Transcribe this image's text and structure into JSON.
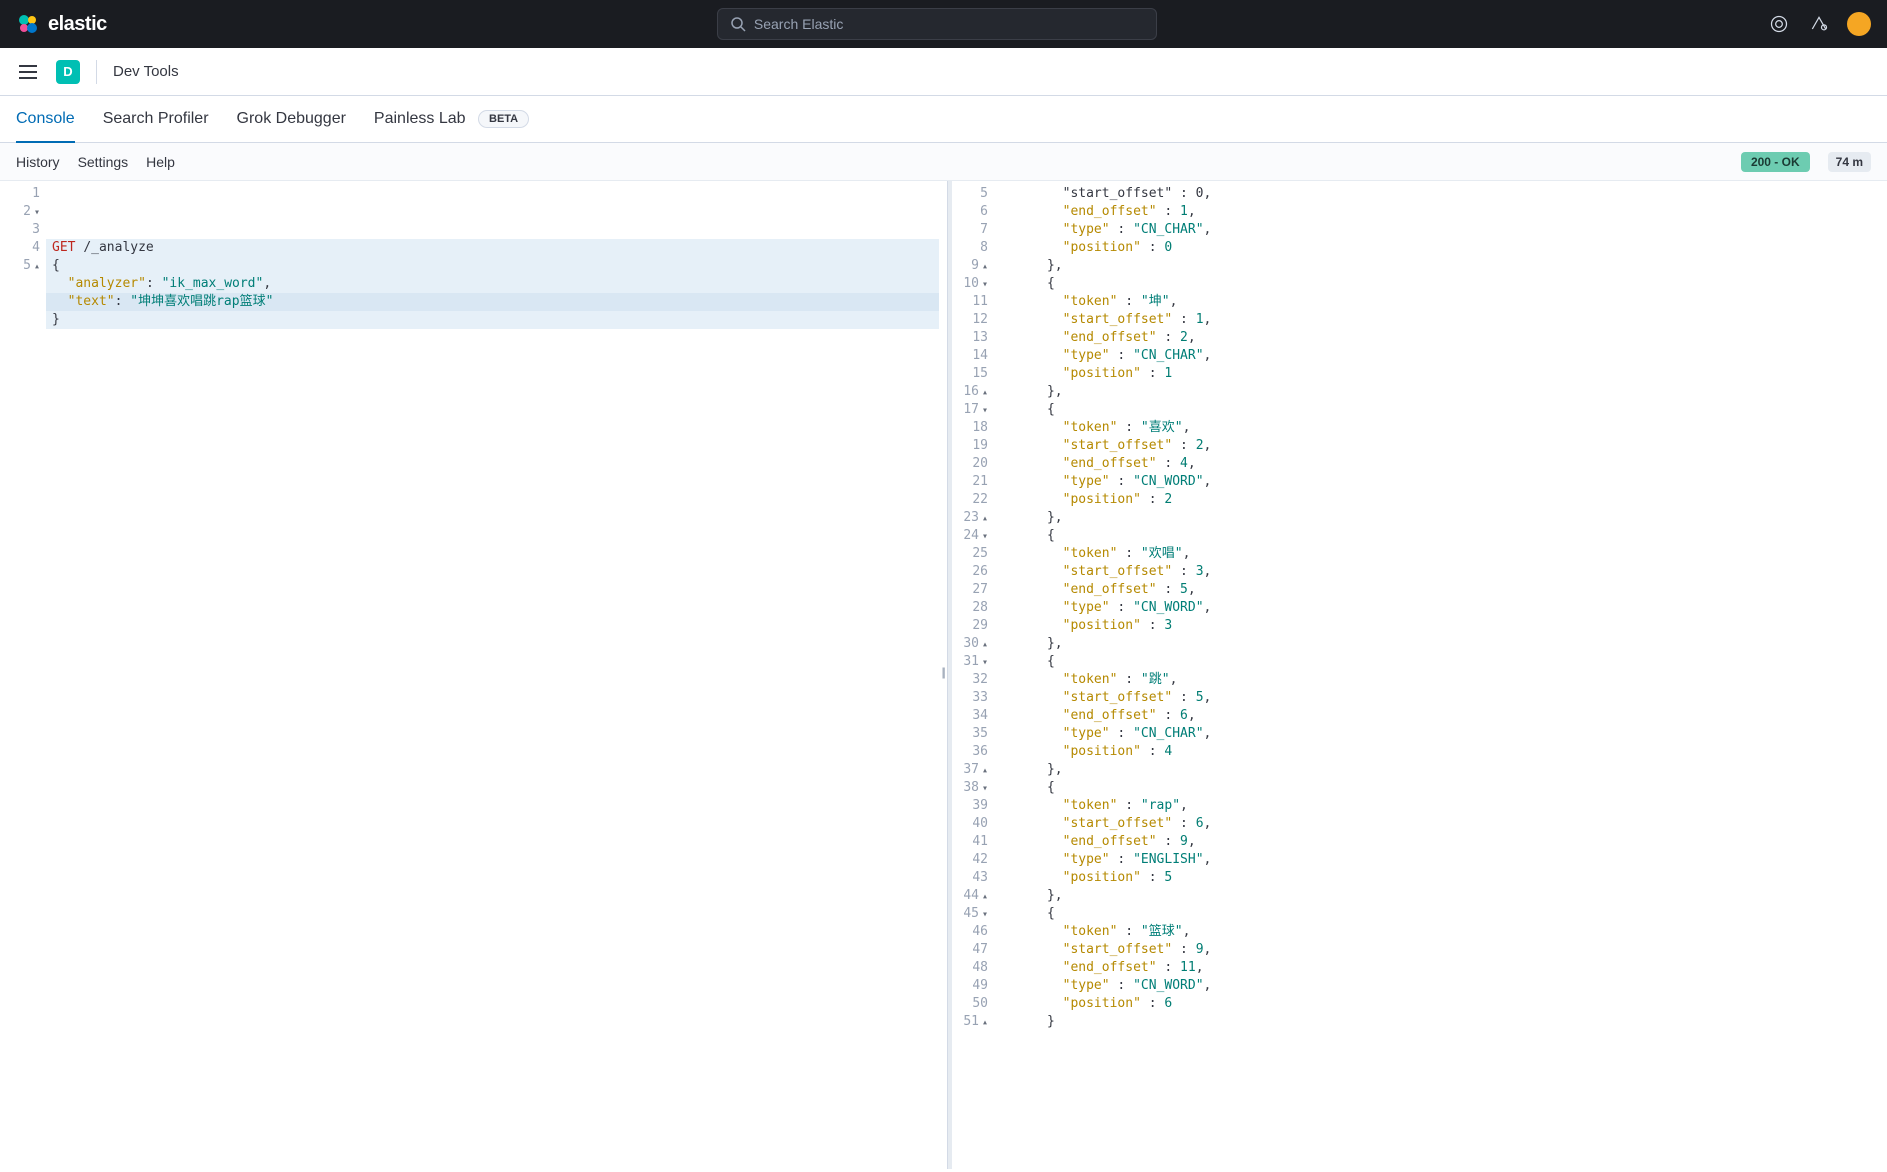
{
  "header": {
    "brand": "elastic",
    "search_placeholder": "Search Elastic"
  },
  "nav": {
    "space_letter": "D",
    "breadcrumb": "Dev Tools"
  },
  "tabs": [
    {
      "label": "Console",
      "active": true
    },
    {
      "label": "Search Profiler",
      "active": false
    },
    {
      "label": "Grok Debugger",
      "active": false
    },
    {
      "label": "Painless Lab",
      "active": false,
      "beta": true
    }
  ],
  "beta_label": "BETA",
  "subtoolbar": {
    "history": "History",
    "settings": "Settings",
    "help": "Help",
    "status": "200 - OK",
    "timing": "74 m"
  },
  "request": {
    "lines": [
      {
        "n": "1",
        "fold": "",
        "parts": [
          {
            "cls": "method",
            "t": "GET"
          },
          {
            "cls": "punct",
            "t": " "
          },
          {
            "cls": "endpoint",
            "t": "/_analyze"
          }
        ]
      },
      {
        "n": "2",
        "fold": "▾",
        "parts": [
          {
            "cls": "punct",
            "t": "{"
          }
        ]
      },
      {
        "n": "3",
        "fold": "",
        "parts": [
          {
            "cls": "punct",
            "t": "  "
          },
          {
            "cls": "key",
            "t": "\"analyzer\""
          },
          {
            "cls": "punct",
            "t": ": "
          },
          {
            "cls": "str",
            "t": "\"ik_max_word\""
          },
          {
            "cls": "punct",
            "t": ","
          }
        ]
      },
      {
        "n": "4",
        "fold": "",
        "active": true,
        "parts": [
          {
            "cls": "punct",
            "t": "  "
          },
          {
            "cls": "key",
            "t": "\"text\""
          },
          {
            "cls": "punct",
            "t": ": "
          },
          {
            "cls": "str",
            "t": "\"坤坤喜欢唱跳rap篮球\""
          }
        ]
      },
      {
        "n": "5",
        "fold": "▴",
        "parts": [
          {
            "cls": "punct",
            "t": "}"
          }
        ]
      }
    ]
  },
  "response": {
    "lines": [
      {
        "n": "5",
        "fold": "",
        "parts": [
          {
            "cls": "punct",
            "t": "        \"start_offset\" : 0,"
          }
        ]
      },
      {
        "n": "6",
        "fold": "",
        "parts": [
          {
            "cls": "punct",
            "t": "        "
          },
          {
            "cls": "key",
            "t": "\"end_offset\""
          },
          {
            "cls": "punct",
            "t": " : "
          },
          {
            "cls": "num",
            "t": "1"
          },
          {
            "cls": "punct",
            "t": ","
          }
        ]
      },
      {
        "n": "7",
        "fold": "",
        "parts": [
          {
            "cls": "punct",
            "t": "        "
          },
          {
            "cls": "key",
            "t": "\"type\""
          },
          {
            "cls": "punct",
            "t": " : "
          },
          {
            "cls": "str",
            "t": "\"CN_CHAR\""
          },
          {
            "cls": "punct",
            "t": ","
          }
        ]
      },
      {
        "n": "8",
        "fold": "",
        "parts": [
          {
            "cls": "punct",
            "t": "        "
          },
          {
            "cls": "key",
            "t": "\"position\""
          },
          {
            "cls": "punct",
            "t": " : "
          },
          {
            "cls": "num",
            "t": "0"
          }
        ]
      },
      {
        "n": "9",
        "fold": "▴",
        "parts": [
          {
            "cls": "punct",
            "t": "      },"
          }
        ]
      },
      {
        "n": "10",
        "fold": "▾",
        "parts": [
          {
            "cls": "punct",
            "t": "      {"
          }
        ]
      },
      {
        "n": "11",
        "fold": "",
        "parts": [
          {
            "cls": "punct",
            "t": "        "
          },
          {
            "cls": "key",
            "t": "\"token\""
          },
          {
            "cls": "punct",
            "t": " : "
          },
          {
            "cls": "str",
            "t": "\"坤\""
          },
          {
            "cls": "punct",
            "t": ","
          }
        ]
      },
      {
        "n": "12",
        "fold": "",
        "parts": [
          {
            "cls": "punct",
            "t": "        "
          },
          {
            "cls": "key",
            "t": "\"start_offset\""
          },
          {
            "cls": "punct",
            "t": " : "
          },
          {
            "cls": "num",
            "t": "1"
          },
          {
            "cls": "punct",
            "t": ","
          }
        ]
      },
      {
        "n": "13",
        "fold": "",
        "parts": [
          {
            "cls": "punct",
            "t": "        "
          },
          {
            "cls": "key",
            "t": "\"end_offset\""
          },
          {
            "cls": "punct",
            "t": " : "
          },
          {
            "cls": "num",
            "t": "2"
          },
          {
            "cls": "punct",
            "t": ","
          }
        ]
      },
      {
        "n": "14",
        "fold": "",
        "parts": [
          {
            "cls": "punct",
            "t": "        "
          },
          {
            "cls": "key",
            "t": "\"type\""
          },
          {
            "cls": "punct",
            "t": " : "
          },
          {
            "cls": "str",
            "t": "\"CN_CHAR\""
          },
          {
            "cls": "punct",
            "t": ","
          }
        ]
      },
      {
        "n": "15",
        "fold": "",
        "parts": [
          {
            "cls": "punct",
            "t": "        "
          },
          {
            "cls": "key",
            "t": "\"position\""
          },
          {
            "cls": "punct",
            "t": " : "
          },
          {
            "cls": "num",
            "t": "1"
          }
        ]
      },
      {
        "n": "16",
        "fold": "▴",
        "parts": [
          {
            "cls": "punct",
            "t": "      },"
          }
        ]
      },
      {
        "n": "17",
        "fold": "▾",
        "parts": [
          {
            "cls": "punct",
            "t": "      {"
          }
        ]
      },
      {
        "n": "18",
        "fold": "",
        "parts": [
          {
            "cls": "punct",
            "t": "        "
          },
          {
            "cls": "key",
            "t": "\"token\""
          },
          {
            "cls": "punct",
            "t": " : "
          },
          {
            "cls": "str",
            "t": "\"喜欢\""
          },
          {
            "cls": "punct",
            "t": ","
          }
        ]
      },
      {
        "n": "19",
        "fold": "",
        "parts": [
          {
            "cls": "punct",
            "t": "        "
          },
          {
            "cls": "key",
            "t": "\"start_offset\""
          },
          {
            "cls": "punct",
            "t": " : "
          },
          {
            "cls": "num",
            "t": "2"
          },
          {
            "cls": "punct",
            "t": ","
          }
        ]
      },
      {
        "n": "20",
        "fold": "",
        "parts": [
          {
            "cls": "punct",
            "t": "        "
          },
          {
            "cls": "key",
            "t": "\"end_offset\""
          },
          {
            "cls": "punct",
            "t": " : "
          },
          {
            "cls": "num",
            "t": "4"
          },
          {
            "cls": "punct",
            "t": ","
          }
        ]
      },
      {
        "n": "21",
        "fold": "",
        "parts": [
          {
            "cls": "punct",
            "t": "        "
          },
          {
            "cls": "key",
            "t": "\"type\""
          },
          {
            "cls": "punct",
            "t": " : "
          },
          {
            "cls": "str",
            "t": "\"CN_WORD\""
          },
          {
            "cls": "punct",
            "t": ","
          }
        ]
      },
      {
        "n": "22",
        "fold": "",
        "parts": [
          {
            "cls": "punct",
            "t": "        "
          },
          {
            "cls": "key",
            "t": "\"position\""
          },
          {
            "cls": "punct",
            "t": " : "
          },
          {
            "cls": "num",
            "t": "2"
          }
        ]
      },
      {
        "n": "23",
        "fold": "▴",
        "parts": [
          {
            "cls": "punct",
            "t": "      },"
          }
        ]
      },
      {
        "n": "24",
        "fold": "▾",
        "parts": [
          {
            "cls": "punct",
            "t": "      {"
          }
        ]
      },
      {
        "n": "25",
        "fold": "",
        "parts": [
          {
            "cls": "punct",
            "t": "        "
          },
          {
            "cls": "key",
            "t": "\"token\""
          },
          {
            "cls": "punct",
            "t": " : "
          },
          {
            "cls": "str",
            "t": "\"欢唱\""
          },
          {
            "cls": "punct",
            "t": ","
          }
        ]
      },
      {
        "n": "26",
        "fold": "",
        "parts": [
          {
            "cls": "punct",
            "t": "        "
          },
          {
            "cls": "key",
            "t": "\"start_offset\""
          },
          {
            "cls": "punct",
            "t": " : "
          },
          {
            "cls": "num",
            "t": "3"
          },
          {
            "cls": "punct",
            "t": ","
          }
        ]
      },
      {
        "n": "27",
        "fold": "",
        "parts": [
          {
            "cls": "punct",
            "t": "        "
          },
          {
            "cls": "key",
            "t": "\"end_offset\""
          },
          {
            "cls": "punct",
            "t": " : "
          },
          {
            "cls": "num",
            "t": "5"
          },
          {
            "cls": "punct",
            "t": ","
          }
        ]
      },
      {
        "n": "28",
        "fold": "",
        "parts": [
          {
            "cls": "punct",
            "t": "        "
          },
          {
            "cls": "key",
            "t": "\"type\""
          },
          {
            "cls": "punct",
            "t": " : "
          },
          {
            "cls": "str",
            "t": "\"CN_WORD\""
          },
          {
            "cls": "punct",
            "t": ","
          }
        ]
      },
      {
        "n": "29",
        "fold": "",
        "parts": [
          {
            "cls": "punct",
            "t": "        "
          },
          {
            "cls": "key",
            "t": "\"position\""
          },
          {
            "cls": "punct",
            "t": " : "
          },
          {
            "cls": "num",
            "t": "3"
          }
        ]
      },
      {
        "n": "30",
        "fold": "▴",
        "parts": [
          {
            "cls": "punct",
            "t": "      },"
          }
        ]
      },
      {
        "n": "31",
        "fold": "▾",
        "parts": [
          {
            "cls": "punct",
            "t": "      {"
          }
        ]
      },
      {
        "n": "32",
        "fold": "",
        "parts": [
          {
            "cls": "punct",
            "t": "        "
          },
          {
            "cls": "key",
            "t": "\"token\""
          },
          {
            "cls": "punct",
            "t": " : "
          },
          {
            "cls": "str",
            "t": "\"跳\""
          },
          {
            "cls": "punct",
            "t": ","
          }
        ]
      },
      {
        "n": "33",
        "fold": "",
        "parts": [
          {
            "cls": "punct",
            "t": "        "
          },
          {
            "cls": "key",
            "t": "\"start_offset\""
          },
          {
            "cls": "punct",
            "t": " : "
          },
          {
            "cls": "num",
            "t": "5"
          },
          {
            "cls": "punct",
            "t": ","
          }
        ]
      },
      {
        "n": "34",
        "fold": "",
        "parts": [
          {
            "cls": "punct",
            "t": "        "
          },
          {
            "cls": "key",
            "t": "\"end_offset\""
          },
          {
            "cls": "punct",
            "t": " : "
          },
          {
            "cls": "num",
            "t": "6"
          },
          {
            "cls": "punct",
            "t": ","
          }
        ]
      },
      {
        "n": "35",
        "fold": "",
        "parts": [
          {
            "cls": "punct",
            "t": "        "
          },
          {
            "cls": "key",
            "t": "\"type\""
          },
          {
            "cls": "punct",
            "t": " : "
          },
          {
            "cls": "str",
            "t": "\"CN_CHAR\""
          },
          {
            "cls": "punct",
            "t": ","
          }
        ]
      },
      {
        "n": "36",
        "fold": "",
        "parts": [
          {
            "cls": "punct",
            "t": "        "
          },
          {
            "cls": "key",
            "t": "\"position\""
          },
          {
            "cls": "punct",
            "t": " : "
          },
          {
            "cls": "num",
            "t": "4"
          }
        ]
      },
      {
        "n": "37",
        "fold": "▴",
        "parts": [
          {
            "cls": "punct",
            "t": "      },"
          }
        ]
      },
      {
        "n": "38",
        "fold": "▾",
        "parts": [
          {
            "cls": "punct",
            "t": "      {"
          }
        ]
      },
      {
        "n": "39",
        "fold": "",
        "parts": [
          {
            "cls": "punct",
            "t": "        "
          },
          {
            "cls": "key",
            "t": "\"token\""
          },
          {
            "cls": "punct",
            "t": " : "
          },
          {
            "cls": "str",
            "t": "\"rap\""
          },
          {
            "cls": "punct",
            "t": ","
          }
        ]
      },
      {
        "n": "40",
        "fold": "",
        "parts": [
          {
            "cls": "punct",
            "t": "        "
          },
          {
            "cls": "key",
            "t": "\"start_offset\""
          },
          {
            "cls": "punct",
            "t": " : "
          },
          {
            "cls": "num",
            "t": "6"
          },
          {
            "cls": "punct",
            "t": ","
          }
        ]
      },
      {
        "n": "41",
        "fold": "",
        "parts": [
          {
            "cls": "punct",
            "t": "        "
          },
          {
            "cls": "key",
            "t": "\"end_offset\""
          },
          {
            "cls": "punct",
            "t": " : "
          },
          {
            "cls": "num",
            "t": "9"
          },
          {
            "cls": "punct",
            "t": ","
          }
        ]
      },
      {
        "n": "42",
        "fold": "",
        "parts": [
          {
            "cls": "punct",
            "t": "        "
          },
          {
            "cls": "key",
            "t": "\"type\""
          },
          {
            "cls": "punct",
            "t": " : "
          },
          {
            "cls": "str",
            "t": "\"ENGLISH\""
          },
          {
            "cls": "punct",
            "t": ","
          }
        ]
      },
      {
        "n": "43",
        "fold": "",
        "parts": [
          {
            "cls": "punct",
            "t": "        "
          },
          {
            "cls": "key",
            "t": "\"position\""
          },
          {
            "cls": "punct",
            "t": " : "
          },
          {
            "cls": "num",
            "t": "5"
          }
        ]
      },
      {
        "n": "44",
        "fold": "▴",
        "parts": [
          {
            "cls": "punct",
            "t": "      },"
          }
        ]
      },
      {
        "n": "45",
        "fold": "▾",
        "parts": [
          {
            "cls": "punct",
            "t": "      {"
          }
        ]
      },
      {
        "n": "46",
        "fold": "",
        "parts": [
          {
            "cls": "punct",
            "t": "        "
          },
          {
            "cls": "key",
            "t": "\"token\""
          },
          {
            "cls": "punct",
            "t": " : "
          },
          {
            "cls": "str",
            "t": "\"篮球\""
          },
          {
            "cls": "punct",
            "t": ","
          }
        ]
      },
      {
        "n": "47",
        "fold": "",
        "parts": [
          {
            "cls": "punct",
            "t": "        "
          },
          {
            "cls": "key",
            "t": "\"start_offset\""
          },
          {
            "cls": "punct",
            "t": " : "
          },
          {
            "cls": "num",
            "t": "9"
          },
          {
            "cls": "punct",
            "t": ","
          }
        ]
      },
      {
        "n": "48",
        "fold": "",
        "parts": [
          {
            "cls": "punct",
            "t": "        "
          },
          {
            "cls": "key",
            "t": "\"end_offset\""
          },
          {
            "cls": "punct",
            "t": " : "
          },
          {
            "cls": "num",
            "t": "11"
          },
          {
            "cls": "punct",
            "t": ","
          }
        ]
      },
      {
        "n": "49",
        "fold": "",
        "parts": [
          {
            "cls": "punct",
            "t": "        "
          },
          {
            "cls": "key",
            "t": "\"type\""
          },
          {
            "cls": "punct",
            "t": " : "
          },
          {
            "cls": "str",
            "t": "\"CN_WORD\""
          },
          {
            "cls": "punct",
            "t": ","
          }
        ]
      },
      {
        "n": "50",
        "fold": "",
        "parts": [
          {
            "cls": "punct",
            "t": "        "
          },
          {
            "cls": "key",
            "t": "\"position\""
          },
          {
            "cls": "punct",
            "t": " : "
          },
          {
            "cls": "num",
            "t": "6"
          }
        ]
      },
      {
        "n": "51",
        "fold": "▴",
        "parts": [
          {
            "cls": "punct",
            "t": "      }"
          }
        ]
      }
    ]
  }
}
